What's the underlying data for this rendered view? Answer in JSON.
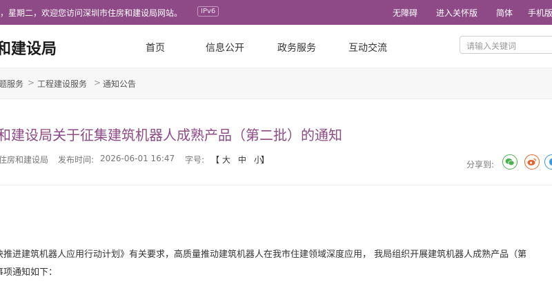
{
  "topbar": {
    "welcome": "，星期二，欢迎您访问深圳市住房和建设局网站。",
    "ipv6": "IPv6",
    "links": [
      "无障碍",
      "进入关怀版",
      "简体",
      "手机版"
    ]
  },
  "header": {
    "logo": "和建设局",
    "nav": [
      "首页",
      "信息公开",
      "政务服务",
      "互动交流"
    ],
    "search_placeholder": "请输入关键词"
  },
  "breadcrumb": [
    "题服务",
    "工程建设服务",
    "通知公告"
  ],
  "breadcrumb_sep": ">",
  "article": {
    "title": "和建设局关于征集建筑机器人成熟产品（第二批）的通知",
    "source": "住房和建设局",
    "publish_label": "发布时间:",
    "publish_time": "2026-06-01 16:47",
    "fontsize_label": "字号:",
    "fontsize_open": "【",
    "fontsize_options": [
      "大",
      "中",
      "小"
    ],
    "fontsize_close": "】",
    "share_label": "分享到:",
    "share_icons": [
      "wechat-icon",
      "weibo-icon",
      "qq-icon"
    ],
    "body": [
      "块推进建筑机器人应用行动计划》有关要求，高质量推动建筑机器人在我市住建领域深度应用，  我局组织开展建筑机器人成熟产品（第",
      "事项通知如下："
    ]
  },
  "colors": {
    "brand": "#8e4a86",
    "wechat": "#4caf50",
    "weibo": "#e8632c",
    "qq": "#3d9ad9"
  }
}
